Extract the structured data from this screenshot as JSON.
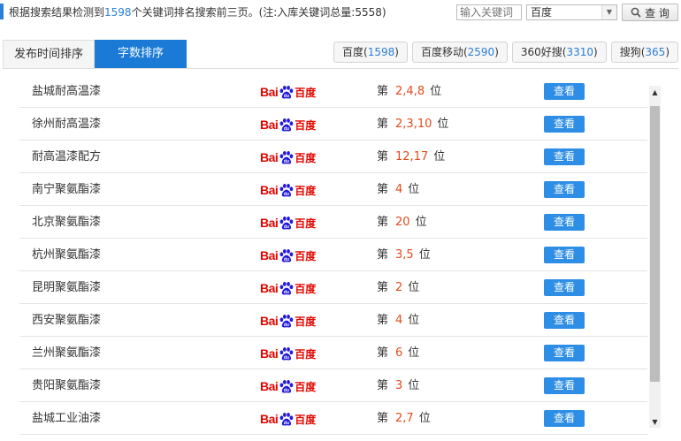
{
  "summary": {
    "prefix": "根据搜索结果检测到",
    "count": "1598",
    "suffix": "个关键词排名搜索前三页。(注:入库关键词总量:5558)"
  },
  "search": {
    "placeholder": "输入关键词",
    "engine_selected": "百度",
    "button_label": "查 询"
  },
  "tabs": [
    {
      "label": "发布时间排序",
      "active": false
    },
    {
      "label": "字数排序",
      "active": true
    }
  ],
  "engines": [
    {
      "name": "百度",
      "count": "1598"
    },
    {
      "name": "百度移动",
      "count": "2590"
    },
    {
      "name": "360好搜",
      "count": "3310"
    },
    {
      "name": "搜狗",
      "count": "365"
    }
  ],
  "logo_text": {
    "bai": "Bai",
    "du": "百度"
  },
  "rank_prefix": "第",
  "rank_suffix": "位",
  "view_label": "查看",
  "rows": [
    {
      "keyword": "盐城耐高温漆",
      "ranks": "2,4,8"
    },
    {
      "keyword": "徐州耐高温漆",
      "ranks": "2,3,10"
    },
    {
      "keyword": "耐高温漆配方",
      "ranks": "12,17"
    },
    {
      "keyword": "南宁聚氨酯漆",
      "ranks": "4"
    },
    {
      "keyword": "北京聚氨酯漆",
      "ranks": "20"
    },
    {
      "keyword": "杭州聚氨酯漆",
      "ranks": "3,5"
    },
    {
      "keyword": "昆明聚氨酯漆",
      "ranks": "2"
    },
    {
      "keyword": "西安聚氨酯漆",
      "ranks": "4"
    },
    {
      "keyword": "兰州聚氨酯漆",
      "ranks": "6"
    },
    {
      "keyword": "贵阳聚氨酯漆",
      "ranks": "3"
    },
    {
      "keyword": "盐城工业油漆",
      "ranks": "2,7"
    }
  ],
  "colors": {
    "accent": "#1a7ad6",
    "button": "#2e8ee6",
    "rank": "#e54a1a",
    "baidu_red": "#e10600",
    "baidu_blue": "#2319dc"
  }
}
